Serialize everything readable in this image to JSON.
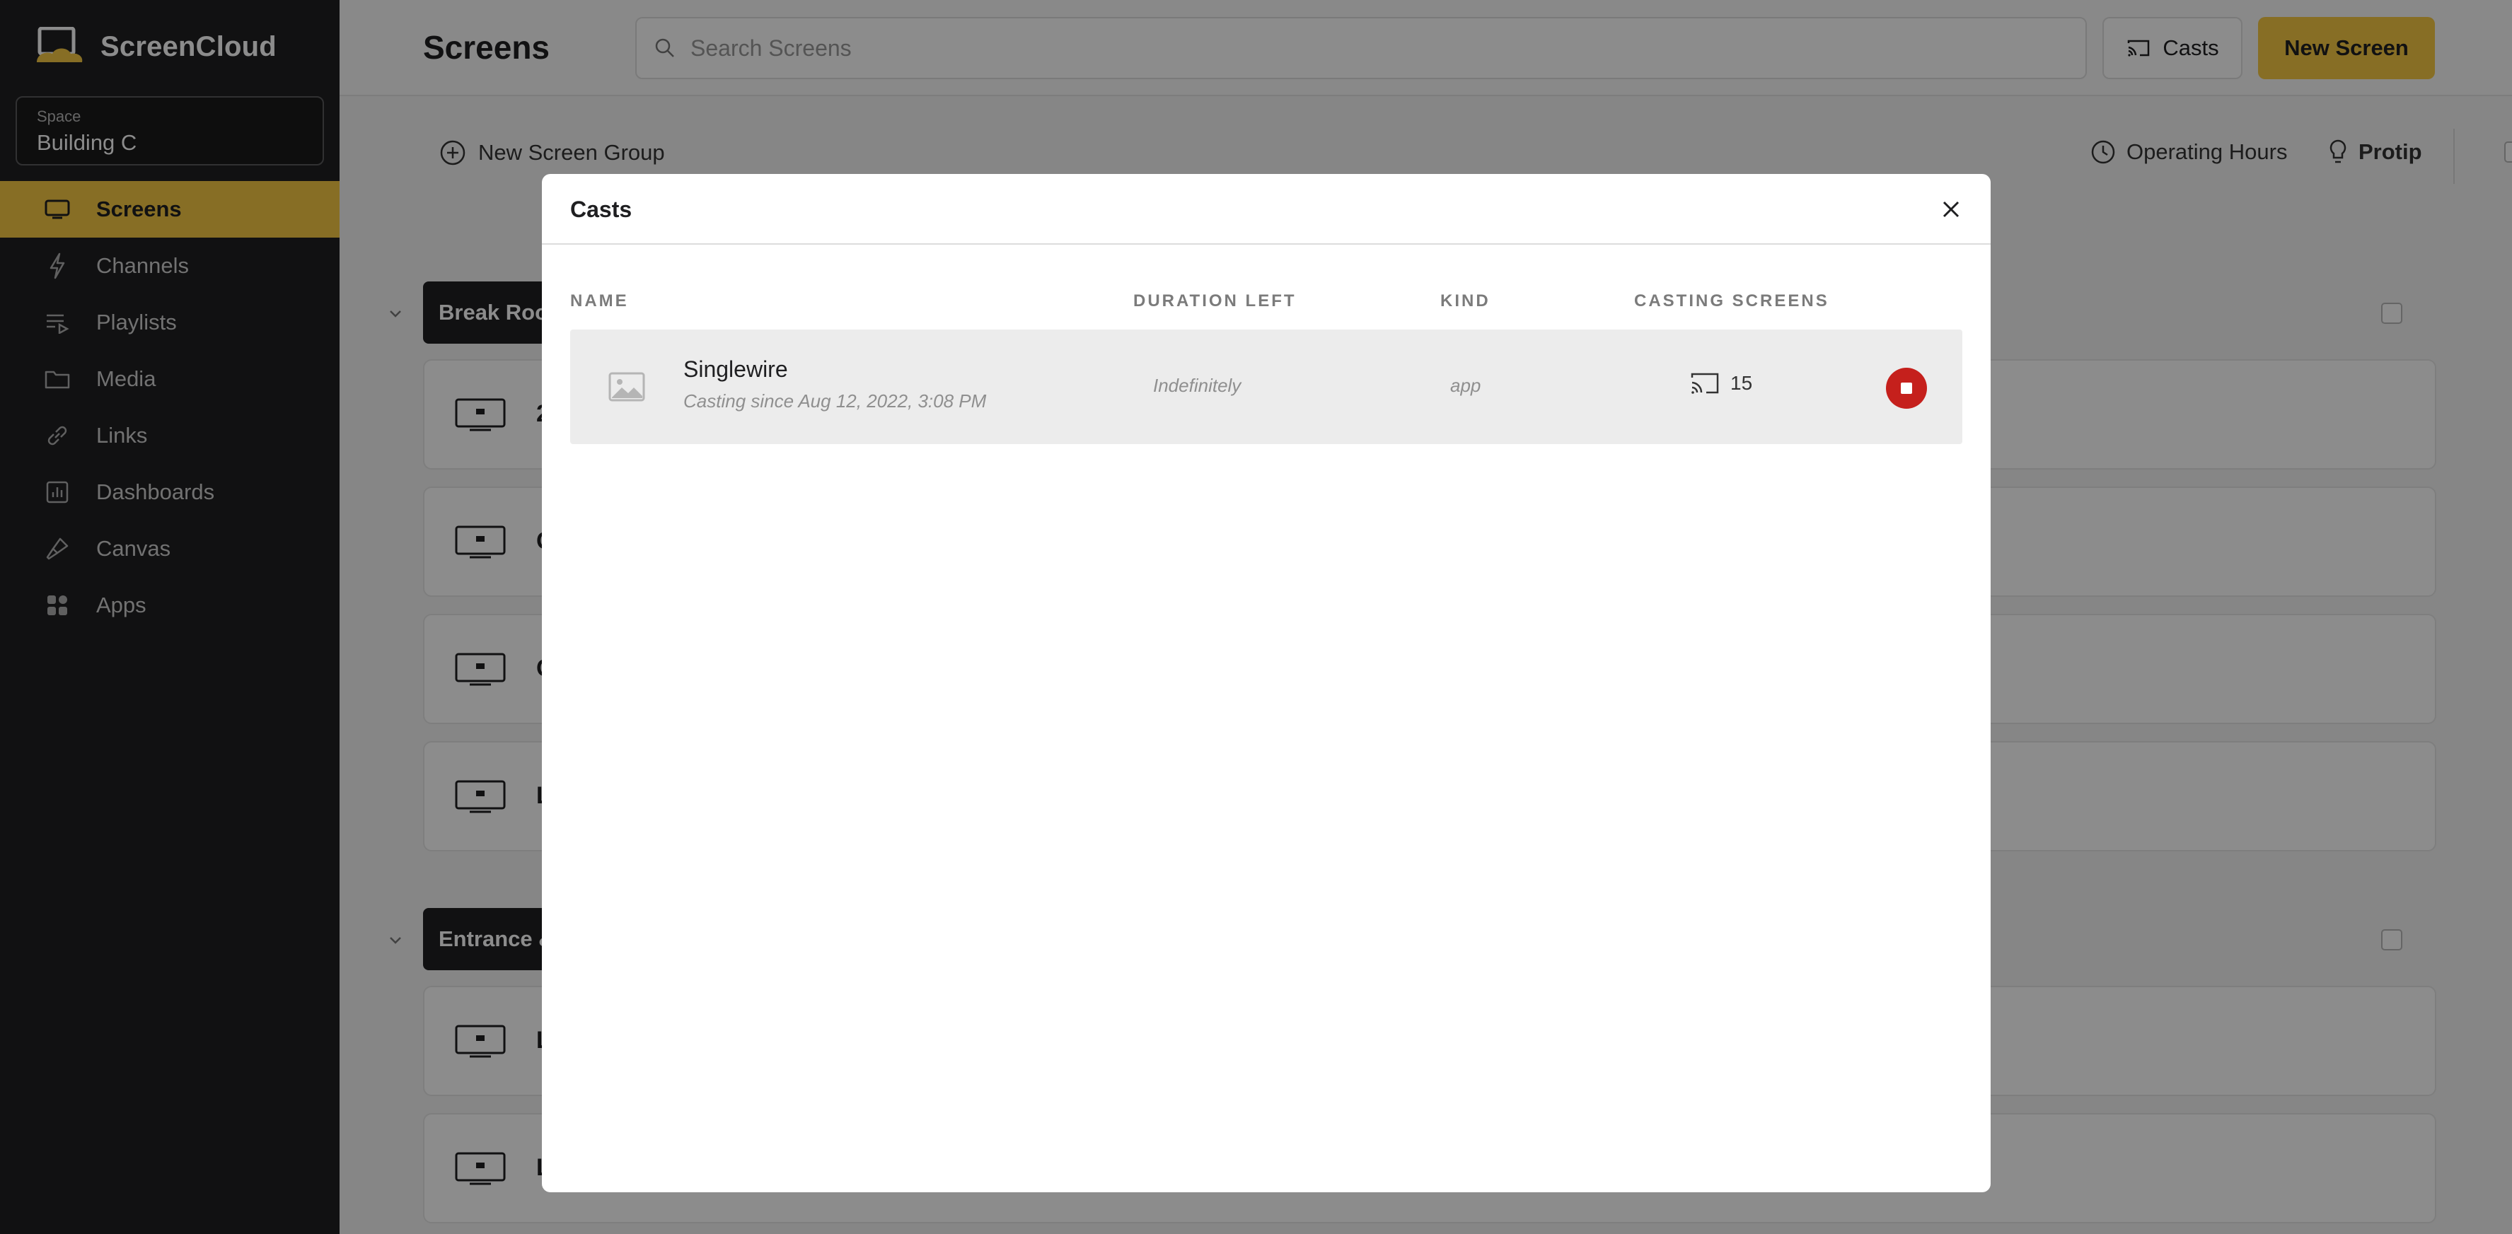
{
  "app": {
    "name": "ScreenCloud"
  },
  "space": {
    "label": "Space",
    "value": "Building C"
  },
  "sidebar": {
    "items": [
      {
        "label": "Screens",
        "icon": "screen-icon",
        "active": true
      },
      {
        "label": "Channels",
        "icon": "lightning-icon"
      },
      {
        "label": "Playlists",
        "icon": "playlist-icon"
      },
      {
        "label": "Media",
        "icon": "folder-icon"
      },
      {
        "label": "Links",
        "icon": "link-icon"
      },
      {
        "label": "Dashboards",
        "icon": "dashboard-icon"
      },
      {
        "label": "Canvas",
        "icon": "brush-icon"
      },
      {
        "label": "Apps",
        "icon": "apps-icon"
      }
    ]
  },
  "header": {
    "title": "Screens",
    "search_placeholder": "Search Screens",
    "casts_label": "Casts",
    "new_screen_label": "New Screen"
  },
  "toolbar": {
    "new_group_label": "New Screen Group",
    "operating_hours_label": "Operating Hours",
    "protip_label": "Protip"
  },
  "groups": [
    {
      "name": "Break Roo"
    },
    {
      "name": "Entrance &"
    }
  ],
  "background_rows": [
    {
      "name": "2"
    },
    {
      "name": "C"
    },
    {
      "name": "C"
    },
    {
      "name": "L"
    },
    {
      "name": "L"
    },
    {
      "name": "L"
    }
  ],
  "modal": {
    "title": "Casts",
    "columns": [
      "NAME",
      "DURATION LEFT",
      "KIND",
      "CASTING SCREENS"
    ],
    "rows": [
      {
        "name": "Singlewire",
        "since": "Casting since Aug 12, 2022, 3:08 PM",
        "duration": "Indefinitely",
        "kind": "app",
        "screens": "15"
      }
    ]
  },
  "colors": {
    "accent": "#f6c944",
    "sidebar_bg": "#1f1f21",
    "stop": "#c5201c"
  }
}
